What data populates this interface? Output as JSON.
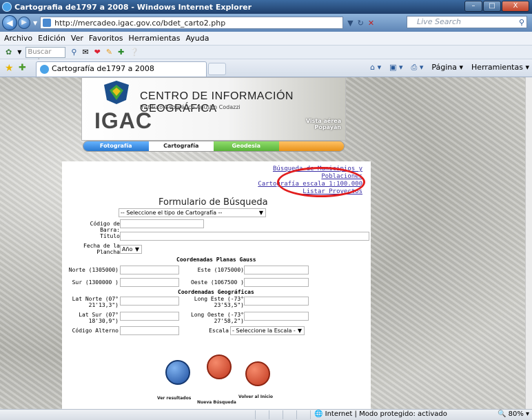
{
  "window": {
    "title": "Cartografia de1797 a 2008 - Windows Internet Explorer"
  },
  "address": {
    "url": "http://mercadeo.igac.gov.co/bdet_carto2.php",
    "search_placeholder": "Live Search"
  },
  "menu": {
    "items": [
      "Archivo",
      "Edición",
      "Ver",
      "Favoritos",
      "Herramientas",
      "Ayuda"
    ]
  },
  "toolbar": {
    "search_web": "Buscar web.."
  },
  "tab": {
    "title": "Cartografía de1797 a 2008",
    "page_label": "Página",
    "tools_label": "Herramientas"
  },
  "banner": {
    "title": "CENTRO DE INFORMACIÓN GEOGRÁFICA",
    "subtitle": "Instituto Geográfico Agustín Codazzi",
    "brand": "IGAC",
    "photo_caption_1": "Vista aérea",
    "photo_caption_2": "Popayán",
    "nav": [
      "Fotografía",
      "Cartografía",
      "Geodesia"
    ]
  },
  "links": {
    "municipios_1": "Búsqueda de Municipios y",
    "municipios_2": "Poblaciones",
    "escala": "Cartografía escala 1:100.000",
    "proyectos": "Listar Proyectos"
  },
  "form": {
    "title": "Formulario de Búsqueda",
    "tipo_select": "-- Seleccione el tipo de Cartografía --",
    "codigo_barra": "Código de Barra:",
    "titulo": "Título",
    "fecha_1": "Fecha de la",
    "fecha_2": "Plancha",
    "anio": "Año",
    "gauss_head": "Coordenadas Planas Gauss",
    "norte": "Norte (1305000)",
    "este": "Este (1075000)",
    "sur": "Sur (1300000 )",
    "oeste": "Oeste (1067500 )",
    "geo_head": "Coordenadas Geográficas",
    "lat_norte_1": "Lat Norte (07°",
    "lat_norte_2": "21'13,3\")",
    "long_este_1": "Long Este (-73°",
    "long_este_2": "23'53,5\")",
    "lat_sur_1": "Lat Sur (07°",
    "lat_sur_2": "18'30,9\")",
    "long_oeste_1": "Long Oeste (-73°",
    "long_oeste_2": "27'58,2\")",
    "codigo_alterno": "Código Alterno",
    "escala": "Escala",
    "escala_select": "- Seleccione la Escala -",
    "ver_resultados": "Ver resultados",
    "nueva_busqueda": "Nueva Búsqueda",
    "volver": "Volver al Inicio"
  },
  "status": {
    "zone": "Internet | Modo protegido: activado",
    "zoom": "80%"
  },
  "colors": {
    "link": "#3b2fa6",
    "highlight_oval": "#e21d1d",
    "title_bar": "#1f3f6a"
  }
}
